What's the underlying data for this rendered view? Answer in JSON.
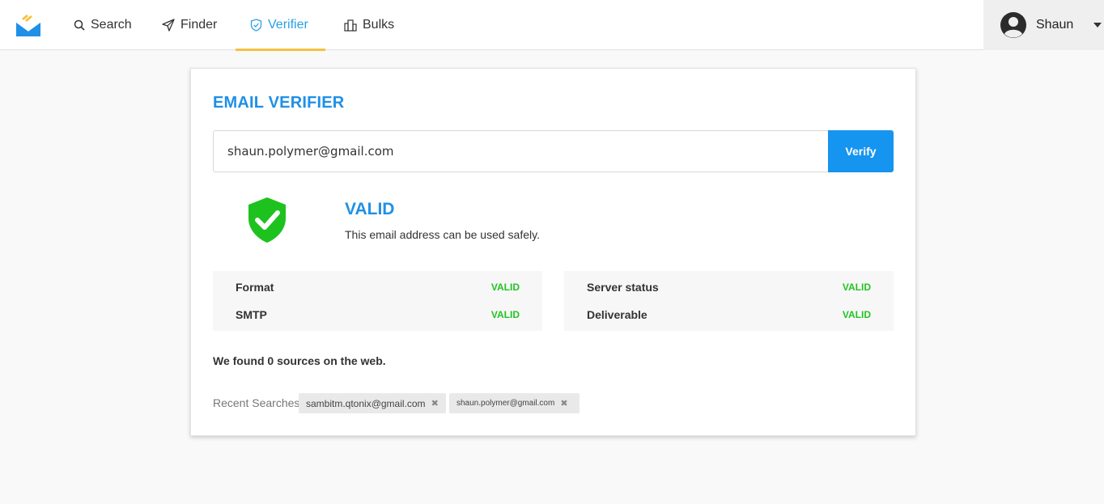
{
  "nav": {
    "items": [
      {
        "label": "Search",
        "icon": "search-icon"
      },
      {
        "label": "Finder",
        "icon": "paper-plane-icon"
      },
      {
        "label": "Verifier",
        "icon": "shield-check-icon",
        "active": true
      },
      {
        "label": "Bulks",
        "icon": "buildings-icon"
      }
    ],
    "active_color": "#2aa0e6",
    "underline_color": "#f5c242"
  },
  "user": {
    "name": "Shaun"
  },
  "verifier": {
    "title": "EMAIL VERIFIER",
    "email_value": "shaun.polymer@gmail.com",
    "verify_label": "Verify",
    "result": {
      "status": "VALID",
      "message": "This email address can be used safely."
    },
    "checks_left": [
      {
        "label": "Format",
        "value": "VALID"
      },
      {
        "label": "SMTP",
        "value": "VALID"
      }
    ],
    "checks_right": [
      {
        "label": "Server status",
        "value": "VALID"
      },
      {
        "label": "Deliverable",
        "value": "VALID"
      }
    ],
    "sources_text": "We found 0 sources on the web.",
    "recent_label": "Recent Searches",
    "recent": [
      "sambitm.qtonix@gmail.com",
      "shaun.polymer@gmail.com"
    ]
  },
  "colors": {
    "accent": "#1f90e6",
    "button": "#1594f0",
    "valid_green": "#22c322",
    "shield_green": "#1ec21e"
  }
}
